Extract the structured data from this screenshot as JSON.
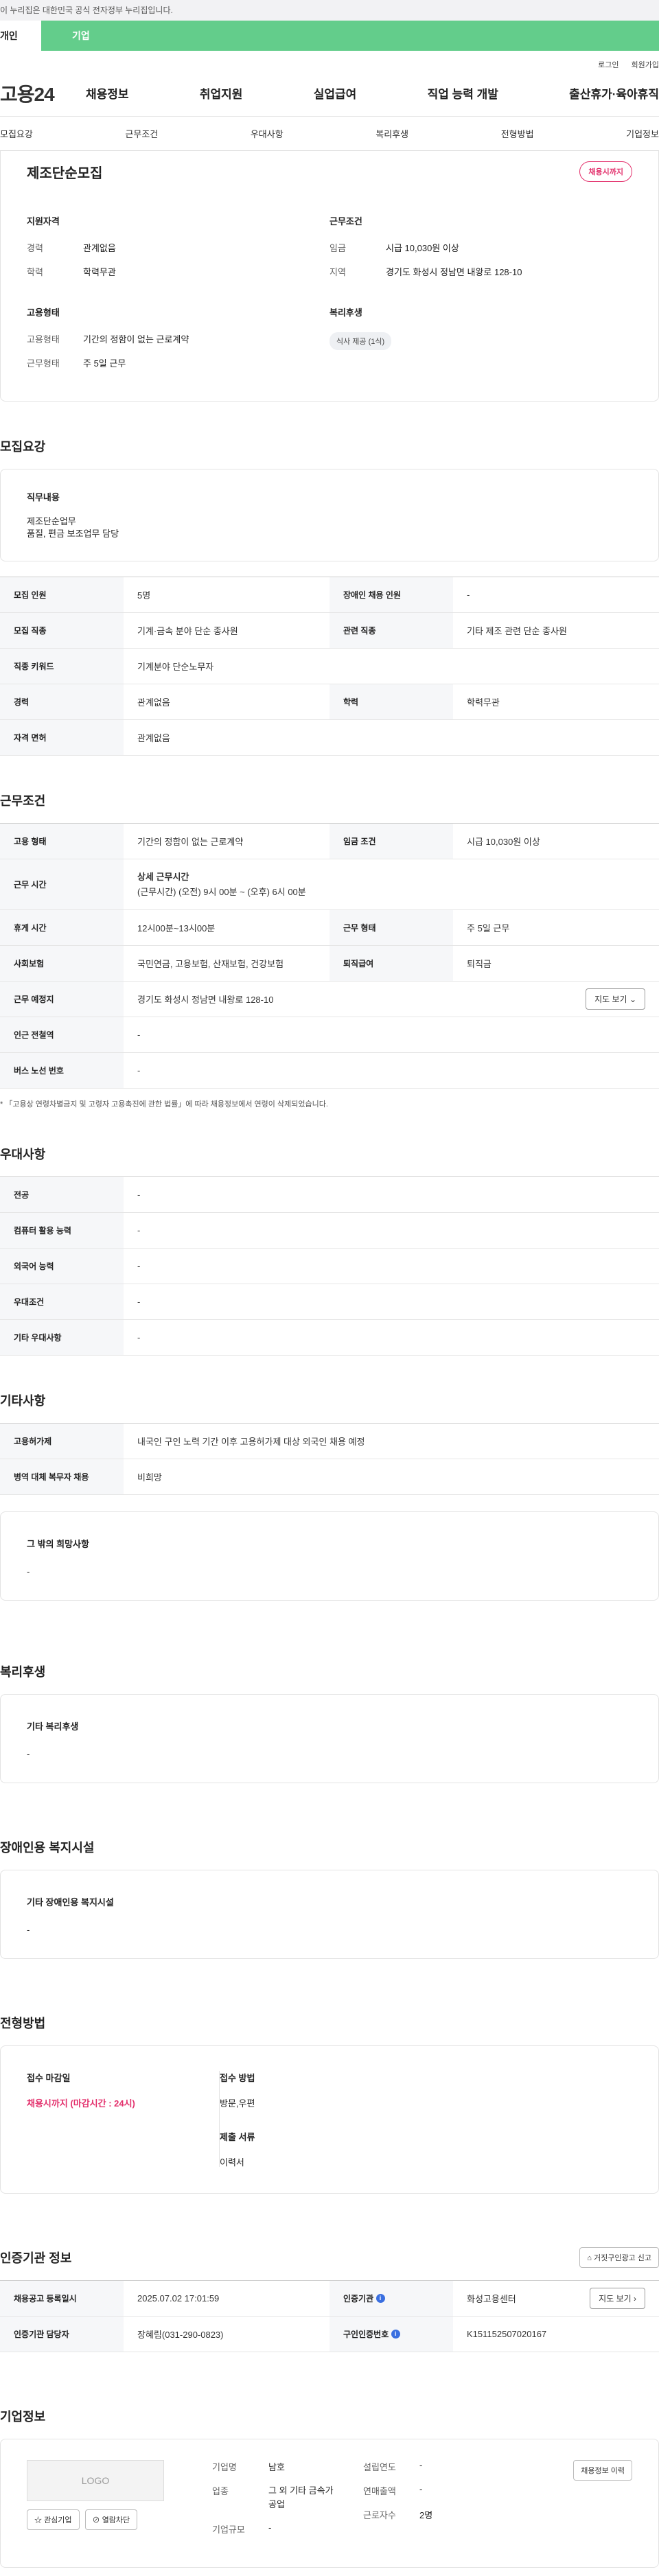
{
  "gov_banner": "이 누리집은 대한민국 공식 전자정부 누리집입니다.",
  "top_tabs": {
    "personal": "개인",
    "company": "기업"
  },
  "util_links": {
    "login": "로그인",
    "join": "회원가입"
  },
  "logo": "고용24",
  "gnb": [
    "채용정보",
    "취업지원",
    "실업급여",
    "직업 능력 개발",
    "출산휴가·육아휴직"
  ],
  "anchor_tabs": [
    "모집요강",
    "근무조건",
    "우대사항",
    "복리후생",
    "전형방법",
    "기업정보"
  ],
  "summary": {
    "title": "제조단순모집",
    "badge": "채용시까지",
    "qual_title": "지원자격",
    "experience_label": "경력",
    "experience": "관계없음",
    "education_label": "학력",
    "education": "학력무관",
    "employment_title": "고용형태",
    "emp_type_label": "고용형태",
    "emp_type": "기간의 정함이 없는 근로계약",
    "work_type_label": "근무형태",
    "work_type": "주 5일 근무",
    "cond_title": "근무조건",
    "wage_label": "임금",
    "wage": "시급 10,030원 이상",
    "region_label": "지역",
    "region": "경기도 화성시 정남면 내왕로 128-10",
    "welfare_title": "복리후생",
    "welfare_chip": "식사 제공 (1식)"
  },
  "recruit": {
    "title": "모집요강",
    "duty_title": "직무내용",
    "duty_lines": [
      "제조단순업무",
      "품질, 편금 보조업무 담당"
    ],
    "rows": {
      "headcount_label": "모집 인원",
      "headcount": "5명",
      "disabled_label": "장애인 채용 인원",
      "disabled": "-",
      "job_label": "모집 직종",
      "job": "기계·금속 분야 단순 종사원",
      "related_label": "관련 직종",
      "related": "기타 제조 관련 단순 종사원",
      "keyword_label": "직종 키워드",
      "keyword": "기계분야 단순노무자",
      "exp_label": "경력",
      "exp": "관계없음",
      "edu_label": "학력",
      "edu": "학력무관",
      "license_label": "자격 면허",
      "license": "관계없음"
    }
  },
  "conditions": {
    "title": "근무조건",
    "emp_label": "고용 형태",
    "emp": "기간의 정함이 없는 근로계약",
    "wage_label": "임금 조건",
    "wage": "시급 10,030원 이상",
    "hours_label": "근무 시간",
    "hours_title": "상세 근무시간",
    "hours_detail": "(근무시간) (오전) 9시 00분 ~ (오후) 6시 00분",
    "break_label": "휴게 시간",
    "break": "12시00분~13시00분",
    "work_label": "근무 형태",
    "work": "주 5일 근무",
    "insurance_label": "사회보험",
    "insurance": "국민연금, 고용보험, 산재보험, 건강보험",
    "severance_label": "퇴직급여",
    "severance": "퇴직금",
    "place_label": "근무 예정지",
    "place": "경기도 화성시 정남면 내왕로 128-10",
    "map_btn": "지도 보기",
    "subway_label": "인근 전철역",
    "subway": "-",
    "bus_label": "버스 노선 번호",
    "bus": "-",
    "note": "* 「고용상 연령차별금지 및 고령자 고용촉진에 관한 법률」에 따라 채용정보에서 연령이 삭제되었습니다."
  },
  "preference": {
    "title": "우대사항",
    "rows": [
      {
        "label": "전공",
        "value": "-"
      },
      {
        "label": "컴퓨터 활용 능력",
        "value": "-"
      },
      {
        "label": "외국어 능력",
        "value": "-"
      },
      {
        "label": "우대조건",
        "value": "-"
      },
      {
        "label": "기타 우대사항",
        "value": "-"
      }
    ]
  },
  "etc": {
    "title": "기타사항",
    "rows": [
      {
        "label": "고용허가제",
        "value": "내국인 구인 노력 기간 이후 고용허가제 대상 외국인 채용 예정"
      },
      {
        "label": "병역 대체 복무자 채용",
        "value": "비희망"
      }
    ],
    "other_title": "그 밖의 희망사항",
    "other_value": "-"
  },
  "welfare": {
    "title": "복리후생",
    "box_title": "기타 복리후생",
    "box_value": "-"
  },
  "disabled": {
    "title": "장애인용 복지시설",
    "box_title": "기타 장애인용 복지시설",
    "box_value": "-"
  },
  "selection": {
    "title": "전형방법",
    "deadline_title": "접수 마감일",
    "deadline": "채용시까지 (마감시간 : 24시)",
    "method_title": "접수 방법",
    "method": "방문,우편",
    "docs_title": "제출 서류",
    "docs": "이력서"
  },
  "agency": {
    "title": "인증기관 정보",
    "report_btn": "거짓구인광고 신고",
    "reg_label": "채용공고 등록일시",
    "reg": "2025.07.02 17:01:59",
    "agency_label": "인증기관",
    "agency": "화성고용센터",
    "view_btn": "지도 보기",
    "manager_label": "인증기관 담당자",
    "manager": "장혜림(031-290-0823)",
    "job_no_label": "구인인증번호",
    "job_no": "K151152507020167"
  },
  "company": {
    "title": "기업정보",
    "logo_text": "LOGO",
    "interest_btn": "관심기업",
    "block_btn": "열람차단",
    "name_label": "기업명",
    "name": "남호",
    "industry_label": "업종",
    "industry_l1": "그 외 기타 금속가",
    "industry_l2": "공업",
    "size_label": "기업규모",
    "size": "-",
    "year_label": "설립연도",
    "year": "-",
    "sales_label": "연매출액",
    "sales": "-",
    "employees_label": "근로자수",
    "employees": "2명",
    "history_btn": "채용정보 이력"
  }
}
